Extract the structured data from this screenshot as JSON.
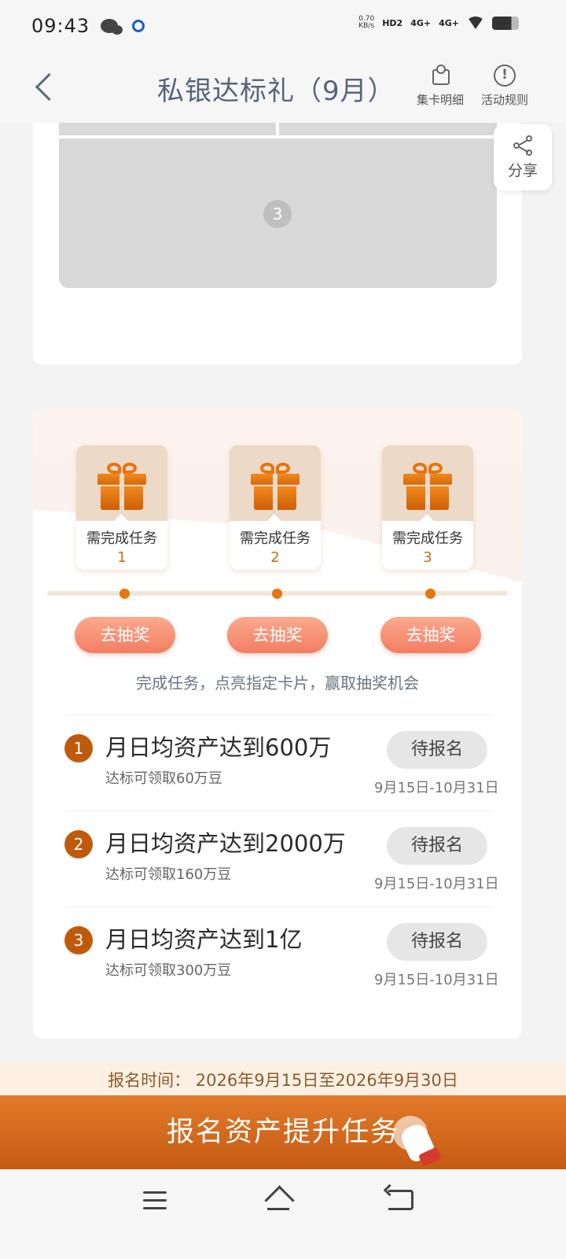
{
  "status_bar": {
    "time": "09:43",
    "speed": "0.70\nKB/s",
    "hd": "HD2",
    "net1": "4G+",
    "net2": "4G+",
    "icons": [
      "wechat-icon",
      "app-icon",
      "hd-icon",
      "signal-icon",
      "signal-icon",
      "wifi-icon",
      "battery-icon"
    ]
  },
  "header": {
    "title": "私银达标礼（9月）",
    "actions": [
      {
        "label": "集卡明细",
        "icon": "puzzle-icon"
      },
      {
        "label": "活动规则",
        "icon": "info-icon"
      }
    ]
  },
  "share": {
    "label": "分享",
    "icon": "share-icon"
  },
  "card_image": {
    "number": "3"
  },
  "gifts": [
    {
      "text": "需完成任务",
      "num": "1",
      "button": "去抽奖"
    },
    {
      "text": "需完成任务",
      "num": "2",
      "button": "去抽奖"
    },
    {
      "text": "需完成任务",
      "num": "3",
      "button": "去抽奖"
    }
  ],
  "hint": "完成任务，点亮指定卡片，赢取抽奖机会",
  "tasks": [
    {
      "num": "1",
      "title": "月日均资产达到600万",
      "sub": "达标可领取60万豆",
      "button": "待报名",
      "date": "9月15日-10月31日"
    },
    {
      "num": "2",
      "title": "月日均资产达到2000万",
      "sub": "达标可领取160万豆",
      "button": "待报名",
      "date": "9月15日-10月31日"
    },
    {
      "num": "3",
      "title": "月日均资产达到1亿",
      "sub": "达标可领取300万豆",
      "button": "待报名",
      "date": "9月15日-10月31日"
    }
  ],
  "signup_time": "报名时间：  2026年9月15日至2026年9月30日",
  "cta": "报名资产提升任务",
  "colors": {
    "accent": "#e27a2a",
    "task_num": "#c05a0b",
    "draw_btn": "#f27d62"
  }
}
